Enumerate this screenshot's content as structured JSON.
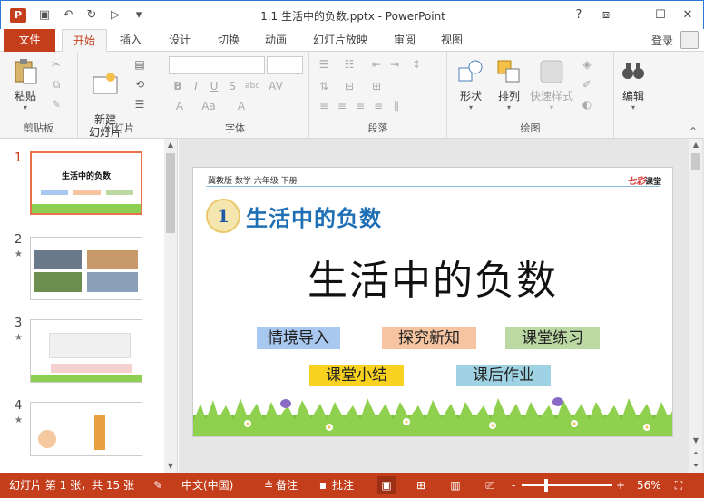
{
  "window": {
    "app_icon": "P",
    "title": "1.1 生活中的负数.pptx - PowerPoint",
    "controls": [
      "?",
      "⧈",
      "—",
      "☐",
      "✕"
    ]
  },
  "quick_access": [
    "save-icon",
    "undo-icon",
    "redo-icon",
    "start-from-beginning-icon",
    "customize-qat-icon"
  ],
  "tabs": [
    {
      "label": "文件"
    },
    {
      "label": "开始"
    },
    {
      "label": "插入"
    },
    {
      "label": "设计"
    },
    {
      "label": "切换"
    },
    {
      "label": "动画"
    },
    {
      "label": "幻灯片放映"
    },
    {
      "label": "审阅"
    },
    {
      "label": "视图"
    }
  ],
  "account": {
    "login_label": "登录"
  },
  "ribbon": {
    "clipboard": {
      "label": "剪贴板",
      "paste_label": "粘贴"
    },
    "slides": {
      "label": "幻灯片",
      "new_slide_label": "新建\n幻灯片"
    },
    "font": {
      "label": "字体"
    },
    "paragraph": {
      "label": "段落"
    },
    "drawing": {
      "label": "绘图",
      "shape_label": "形状",
      "arrange_label": "排列",
      "quick_style_label": "快速样式"
    },
    "editing": {
      "label": "编辑"
    }
  },
  "thumbnails": [
    {
      "number": "1",
      "title": "生活中的负数",
      "starred": false
    },
    {
      "number": "2",
      "star": "★"
    },
    {
      "number": "3",
      "star": "★"
    },
    {
      "number": "4",
      "star": "★"
    }
  ],
  "slide": {
    "header": "冀教版   数学   六年级   下册",
    "brand_main": "七彩",
    "brand_sub": "课堂",
    "lesson_number": "1",
    "lesson_title": "生活中的负数",
    "main_title": "生活中的负数",
    "buttons": [
      {
        "label": "情境导入",
        "color": "#a9c8f0"
      },
      {
        "label": "探究新知",
        "color": "#f6c4a0"
      },
      {
        "label": "课堂练习",
        "color": "#bcd9a4"
      },
      {
        "label": "课堂小结",
        "color": "#f8d21e"
      },
      {
        "label": "课后作业",
        "color": "#9fd3e3"
      }
    ]
  },
  "status_bar": {
    "slide_info": "幻灯片 第 1 张，共 15 张",
    "language": "中文(中国)",
    "notes_label": "备注",
    "comments_label": "批注",
    "zoom_minus": "-",
    "zoom_plus": "+",
    "zoom_level": "56%"
  },
  "colors": {
    "accent": "#c43e1c",
    "tab_active_text": "#c43e1c",
    "lesson_title": "#1f6fb5"
  }
}
